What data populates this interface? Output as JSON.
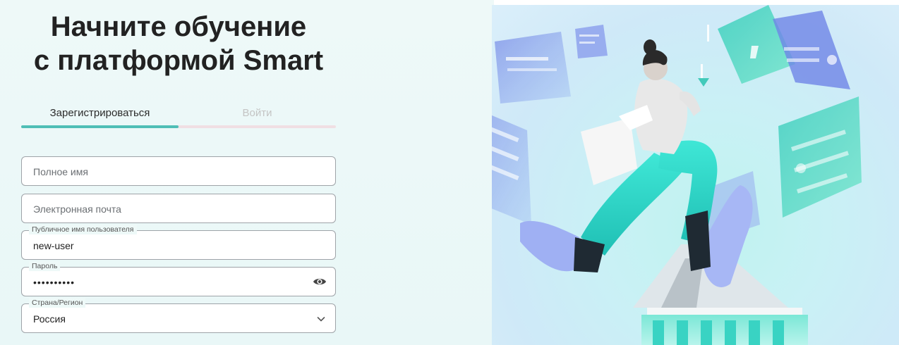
{
  "heading": {
    "line1": "Начните обучение",
    "line2": "с платформой Smart"
  },
  "tabs": [
    {
      "label": "Зарегистрироваться",
      "active": true
    },
    {
      "label": "Войти",
      "active": false
    }
  ],
  "form": {
    "full_name": {
      "placeholder": "Полное имя",
      "value": ""
    },
    "email": {
      "placeholder": "Электронная почта",
      "value": ""
    },
    "username": {
      "label": "Публичное имя пользователя",
      "value": "new-user"
    },
    "password": {
      "label": "Пароль",
      "value": "••••••••••"
    },
    "country": {
      "label": "Страна/Регион",
      "value": "Россия"
    }
  },
  "colors": {
    "accent": "#4fbeb6",
    "tab_track": "#f0dfe3",
    "panel_bg": "#eef9f8",
    "border": "#9ea3a8"
  },
  "icons": {
    "password_toggle": "eye-icon",
    "country_select": "chevron-down-icon"
  }
}
